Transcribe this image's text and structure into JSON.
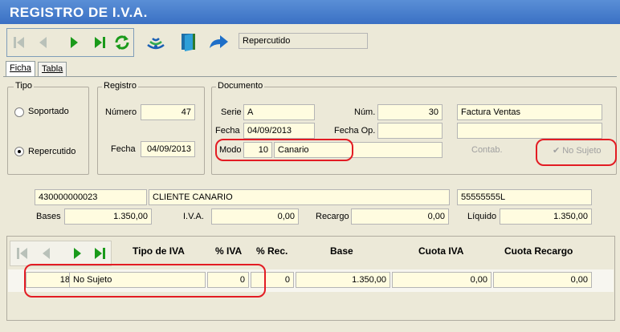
{
  "window": {
    "title": "REGISTRO DE I.V.A."
  },
  "toolbar": {
    "mode_value": "Repercutido"
  },
  "tabs": [
    {
      "label": "Ficha"
    },
    {
      "label": "Tabla"
    }
  ],
  "tipo": {
    "title": "Tipo",
    "options": [
      {
        "label": "Soportado",
        "selected": false
      },
      {
        "label": "Repercutido",
        "selected": true
      }
    ]
  },
  "registro": {
    "title": "Registro",
    "numero_label": "Número",
    "numero_value": "47",
    "fecha_label": "Fecha",
    "fecha_value": "04/09/2013"
  },
  "documento": {
    "title": "Documento",
    "serie_label": "Serie",
    "serie_value": "A",
    "num_label": "Núm.",
    "num_value": "30",
    "desc1_value": "Factura Ventas",
    "fecha_label": "Fecha",
    "fecha_value": "04/09/2013",
    "fecha_op_label": "Fecha Op.",
    "fecha_op_value": "",
    "desc2_value": "",
    "modo_label": "Modo",
    "modo_code": "10",
    "modo_name": "Canario",
    "contab_label": "Contab.",
    "no_sujeto_label": "No Sujeto"
  },
  "cliente": {
    "account": "430000000023",
    "name": "CLIENTE CANARIO",
    "nif": "55555555L"
  },
  "totales": {
    "bases_label": "Bases",
    "bases_value": "1.350,00",
    "iva_label": "I.V.A.",
    "iva_value": "0,00",
    "recargo_label": "Recargo",
    "recargo_value": "0,00",
    "liquido_label": "Líquido",
    "liquido_value": "1.350,00"
  },
  "grid": {
    "headers": [
      "Tipo de IVA",
      "% IVA",
      "% Rec.",
      "Base",
      "Cuota IVA",
      "Cuota Recargo"
    ],
    "rows": [
      {
        "code": "18",
        "tipo": "No Sujeto",
        "pct_iva": "0",
        "pct_rec": "0",
        "base": "1.350,00",
        "cuota_iva": "0,00",
        "cuota_recargo": "0,00"
      }
    ]
  },
  "colors": {
    "title_bar": "#3a70c4",
    "field_bg": "#FFFCE0",
    "highlight": "#e31c23",
    "nav_green": "#1a9a1a"
  }
}
